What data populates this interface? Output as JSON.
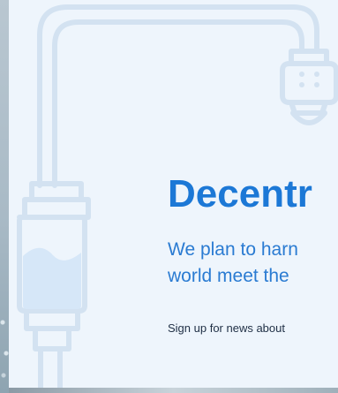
{
  "hero": {
    "title": "Decentr",
    "description_lines": [
      "We plan to harn",
      "world meet the"
    ],
    "newsletter_prompt": "Sign up for news about"
  },
  "icons": {
    "illustration": "pipeline-tube-icon"
  },
  "colors": {
    "hero_background": "#eef5fc",
    "title": "#1c78d6",
    "description": "#2a7bd2",
    "illustration_stroke": "#d3e2f1",
    "fluid": "#d6e7f8"
  }
}
